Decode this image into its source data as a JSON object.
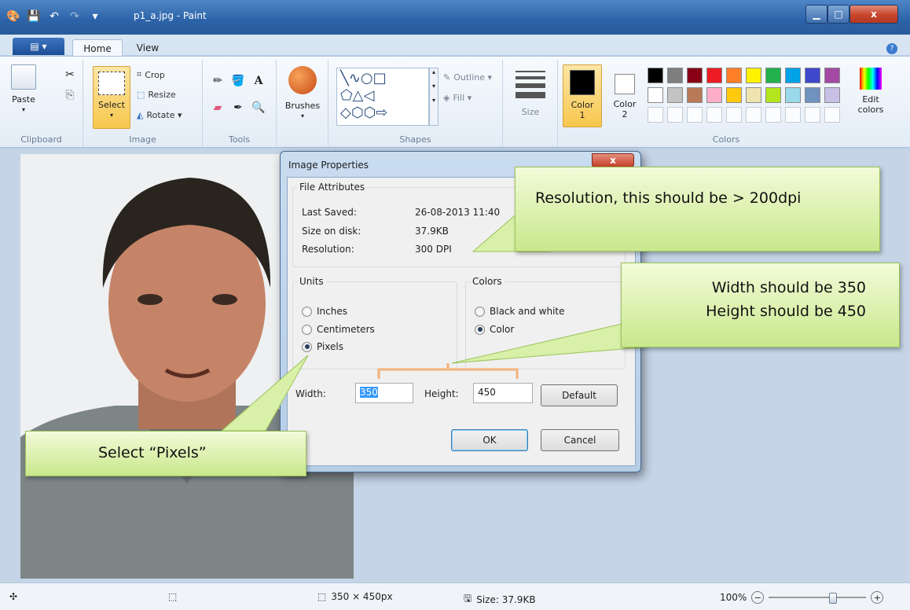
{
  "window": {
    "title": "p1_a.jpg - Paint"
  },
  "menu": {
    "file_button": "▤ ▾",
    "tabs": [
      "Home",
      "View"
    ],
    "help_glyph": "?"
  },
  "ribbon": {
    "clipboard": {
      "label": "Clipboard",
      "paste": "Paste"
    },
    "image": {
      "label": "Image",
      "select": "Select",
      "crop": "Crop",
      "resize": "Resize",
      "rotate": "Rotate ▾"
    },
    "tools": {
      "label": "Tools"
    },
    "brushes": {
      "label": "Brushes"
    },
    "shapes": {
      "label": "Shapes",
      "outline": "Outline ▾",
      "fill": "Fill ▾"
    },
    "size": {
      "label": "Size"
    },
    "colors": {
      "label": "Colors",
      "color1": "Color 1",
      "color2": "Color 2",
      "edit": "Edit colors",
      "color1_value": "#000000",
      "color2_value": "#ffffff",
      "palette_row1": [
        "#000000",
        "#7f7f7f",
        "#880015",
        "#ed1c24",
        "#ff7f27",
        "#fff200",
        "#22b14c",
        "#00a2e8",
        "#3f48cc",
        "#a349a4"
      ],
      "palette_row2": [
        "#ffffff",
        "#c3c3c3",
        "#b97a57",
        "#ffaec9",
        "#ffc90e",
        "#efe4b0",
        "#b5e61d",
        "#99d9ea",
        "#7092be",
        "#c8bfe7"
      ]
    }
  },
  "dialog": {
    "title": "Image Properties",
    "close_glyph": "x",
    "file_attributes": {
      "legend": "File Attributes",
      "last_saved_label": "Last Saved:",
      "last_saved_value": "26-08-2013 11:40",
      "size_label": "Size on disk:",
      "size_value": "37.9KB",
      "resolution_label": "Resolution:",
      "resolution_value": "300 DPI"
    },
    "units": {
      "legend": "Units",
      "options": [
        "Inches",
        "Centimeters",
        "Pixels"
      ],
      "selected": "Pixels"
    },
    "colors": {
      "legend": "Colors",
      "options": [
        "Black and white",
        "Color"
      ],
      "selected": "Color"
    },
    "width_label": "Width:",
    "width_value": "350",
    "height_label": "Height:",
    "height_value": "450",
    "default_button": "Default",
    "ok_button": "OK",
    "cancel_button": "Cancel"
  },
  "callouts": {
    "resolution": "Resolution, this should be > 200dpi",
    "size_line1": "Width should be 350",
    "size_line2": "Height should be 450",
    "pixels": "Select “Pixels”"
  },
  "statusbar": {
    "dimensions": "350 × 450px",
    "size": "Size: 37.9KB",
    "zoom": "100%",
    "zoom_level_percent": 100
  }
}
